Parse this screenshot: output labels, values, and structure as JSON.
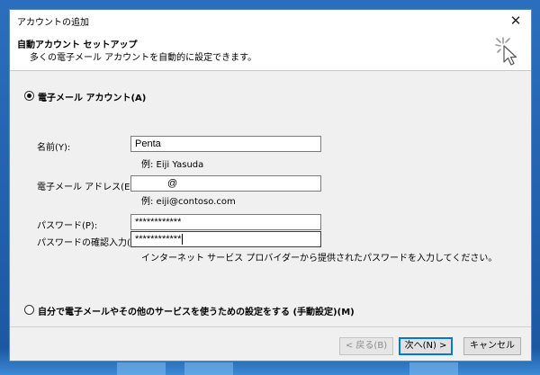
{
  "window": {
    "title": "アカウントの追加",
    "close_glyph": "✕",
    "header_title": "自動アカウント セットアップ",
    "header_subtitle": "多くの電子メール アカウントを自動的に設定できます。"
  },
  "email_account_option": {
    "label": "電子メール アカウント(A)",
    "selected": true
  },
  "form": {
    "name_label": "名前(Y):",
    "name_value": "Penta",
    "name_hint": "例: Eiji Yasuda",
    "email_label": "電子メール アドレス(E):",
    "email_value": "@",
    "email_hint": "例: eiji@contoso.com",
    "password_label": "パスワード(P):",
    "password_value": "************",
    "password_confirm_label": "パスワードの確認入力(T):",
    "password_confirm_value": "************",
    "password_hint": "インターネット サービス プロバイダーから提供されたパスワードを入力してください。"
  },
  "manual_option": {
    "label": "自分で電子メールやその他のサービスを使うための設定をする (手動設定)(M)",
    "selected": false
  },
  "buttons": {
    "back_label": "< 戻る(B)",
    "next_label": "次へ(N) >",
    "cancel_label": "キャンセル"
  },
  "icons": {
    "wizard": "wizard-cursor-icon",
    "close": "close-icon"
  },
  "colors": {
    "accent": "#0078d7",
    "desktop": "#1f5fa8"
  }
}
